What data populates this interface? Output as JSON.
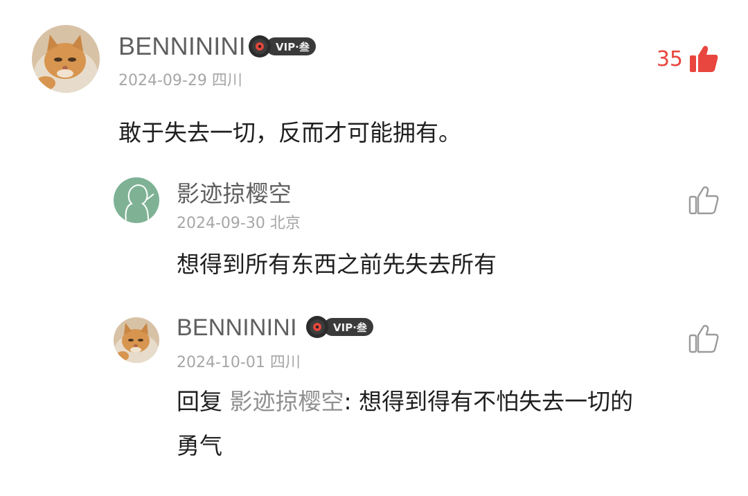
{
  "comments": [
    {
      "username": "BENNININI",
      "vip_label": "VIP·叁",
      "date": "2024-09-29",
      "location": "四川",
      "text": "敢于失去一切，反而才可能拥有。",
      "like_count": "35",
      "liked": true
    },
    {
      "username": "影迹掠樱空",
      "date": "2024-09-30",
      "location": "北京",
      "text": "想得到所有东西之前先失去所有"
    },
    {
      "username": "BENNININI",
      "vip_label": "VIP·叁",
      "date": "2024-10-01",
      "location": "四川",
      "reply_prefix": "回复",
      "reply_target": "影迹掠樱空",
      "reply_text_line1": ": 想得到得有不怕失去一切的",
      "reply_text_line2": "勇气"
    }
  ],
  "colors": {
    "like_active": "#e8463e",
    "like_inactive": "#9a9a9a",
    "username": "#5f5f5f",
    "meta": "#a6a6a6",
    "vip_pill": "#3a3a3a"
  },
  "icons": {
    "like": "thumbs-up-icon",
    "vip": "vinyl-disc-icon"
  }
}
